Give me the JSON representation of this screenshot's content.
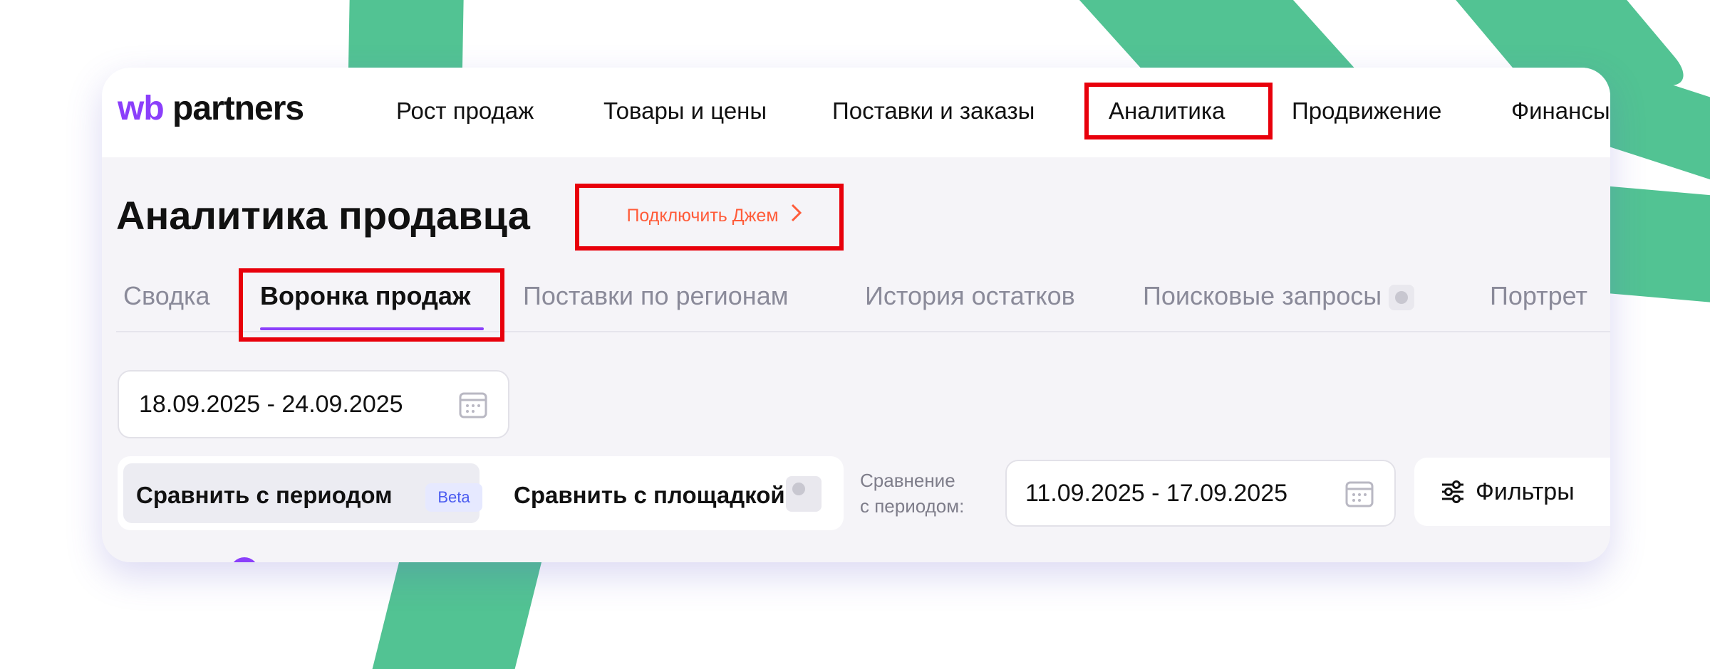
{
  "logo": {
    "wb": "wb",
    "partners": "partners"
  },
  "nav": [
    {
      "label": "Рост продаж"
    },
    {
      "label": "Товары и цены"
    },
    {
      "label": "Поставки и заказы"
    },
    {
      "label": "Аналитика"
    },
    {
      "label": "Продвижение"
    },
    {
      "label": "Финансы"
    }
  ],
  "page": {
    "title": "Аналитика продавца",
    "jam_button": "Подключить Джем"
  },
  "tabs": [
    {
      "label": "Сводка",
      "active": false
    },
    {
      "label": "Воронка продаж",
      "active": true
    },
    {
      "label": "Поставки по регионам",
      "active": false
    },
    {
      "label": "История остатков",
      "active": false
    },
    {
      "label": "Поисковые запросы",
      "active": false
    },
    {
      "label": "Портрет",
      "active": false
    }
  ],
  "date_range": {
    "value": "18.09.2025 - 24.09.2025"
  },
  "compare": {
    "period_label": "Сравнить с периодом",
    "beta_badge": "Beta",
    "platform_label": "Сравнить с площадкой",
    "caption_line1": "Сравнение",
    "caption_line2": "с периодом:",
    "compare_date": "11.09.2025 - 17.09.2025"
  },
  "filters": {
    "label": "Фильтры"
  },
  "icons": {
    "calendar": "calendar-icon",
    "chevron": "chevron-right-icon",
    "filters": "sliders-icon",
    "status": "grey-dot-icon"
  },
  "colors": {
    "accent_purple": "#8b3ffb",
    "highlight_red": "#e8000b",
    "jam_orange": "#ff5c3a",
    "background_green": "#52c393"
  }
}
